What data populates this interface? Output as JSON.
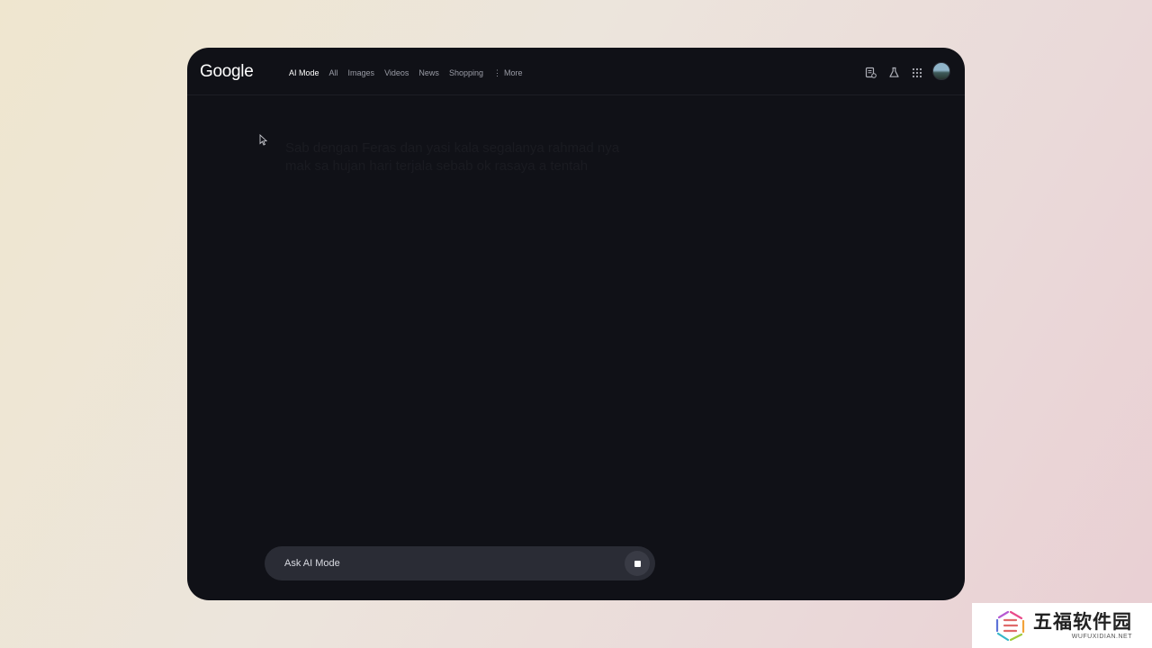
{
  "header": {
    "logo": "Google",
    "tabs": [
      {
        "label": "AI Mode",
        "active": true
      },
      {
        "label": "All"
      },
      {
        "label": "Images"
      },
      {
        "label": "Videos"
      },
      {
        "label": "News"
      },
      {
        "label": "Shopping"
      },
      {
        "label": "More",
        "icon": "more-vert-icon"
      }
    ],
    "actions": [
      "history-icon",
      "labs-flask-icon",
      "apps-grid-icon",
      "profile-avatar"
    ]
  },
  "main": {
    "faded_text": "Sab dengan Feras dan yasi kala segalanya rahmad nya mak sa hujan hari terjala sebab ok rasaya a tentah"
  },
  "search": {
    "placeholder": "Ask AI Mode",
    "stop_icon": "stop-square-icon"
  },
  "watermark": {
    "cn": "五福软件园",
    "en": "WUFUXIDIAN.NET"
  },
  "colors": {
    "frame_bg": "#101117",
    "search_bg": "#2a2c35",
    "active_tab": "#ffffff",
    "inactive_tab": "#9a9ca6"
  }
}
